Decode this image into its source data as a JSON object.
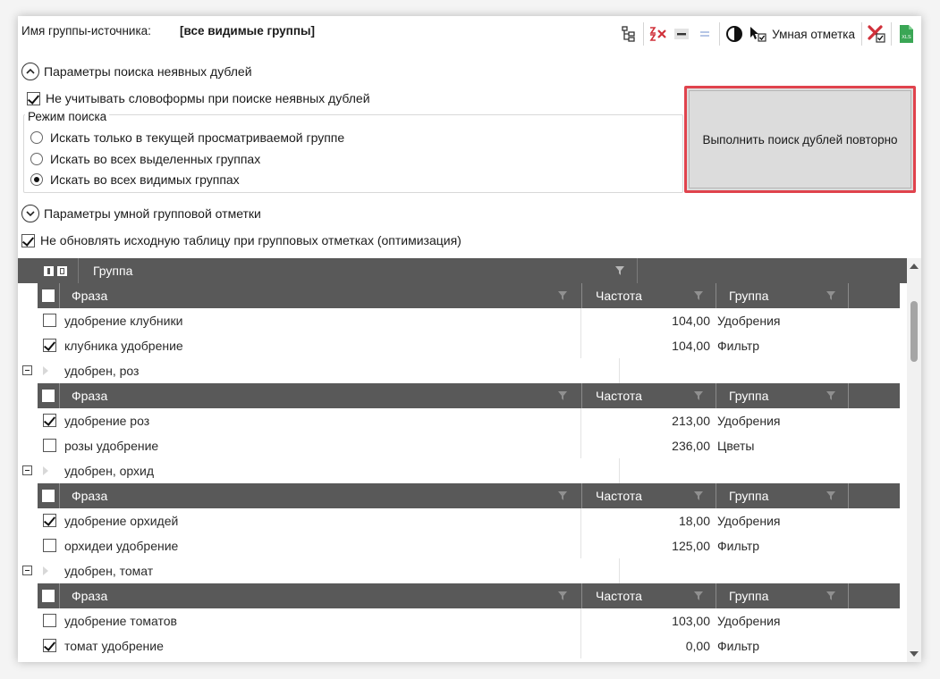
{
  "header": {
    "source_group_label": "Имя группы-источника:",
    "source_group_value": "[все видимые группы]",
    "smart_mark_label": "Умная отметка"
  },
  "toolbar_icons": [
    "tree-expand-icon",
    "clear-marks-icon",
    "minus-icon",
    "equals-icon",
    "contrast-icon",
    "smart-mark-icon",
    "delete-marked-icon",
    "export-excel-icon"
  ],
  "colors": {
    "accent_red": "#e0434d",
    "grid_header": "#595959",
    "excel_green": "#3aa655"
  },
  "search_params": {
    "title": "Параметры поиска неявных дублей",
    "ignore_wordforms_label": "Не учитывать словоформы при поиске неявных дублей",
    "ignore_wordforms_checked": true,
    "mode_title": "Режим поиска",
    "modes": [
      {
        "label": "Искать только в текущей просматриваемой группе",
        "selected": false
      },
      {
        "label": "Искать во всех выделенных группах",
        "selected": false
      },
      {
        "label": "Искать во всех видимых группах",
        "selected": true
      }
    ],
    "rerun_button": "Выполнить поиск дублей повторно"
  },
  "smart_params": {
    "title": "Параметры умной групповой отметки",
    "no_update_label": "Не обновлять исходную таблицу при групповых отметках (оптимизация)",
    "no_update_checked": true
  },
  "grid": {
    "top_header": {
      "column": "Группа"
    },
    "sub_header": {
      "phrase": "Фраза",
      "freq": "Частота",
      "group": "Группа"
    },
    "first_rows": [
      {
        "phrase": "удобрение клубники",
        "freq": "104,00",
        "group": "Удобрения",
        "checked": false
      },
      {
        "phrase": "клубника удобрение",
        "freq": "104,00",
        "group": "Фильтр",
        "checked": true
      }
    ],
    "groups": [
      {
        "name": "удобрен, роз",
        "rows": [
          {
            "phrase": "удобрение роз",
            "freq": "213,00",
            "group": "Удобрения",
            "checked": true
          },
          {
            "phrase": "розы удобрение",
            "freq": "236,00",
            "group": "Цветы",
            "checked": false
          }
        ]
      },
      {
        "name": "удобрен, орхид",
        "rows": [
          {
            "phrase": "удобрение орхидей",
            "freq": "18,00",
            "group": "Удобрения",
            "checked": true
          },
          {
            "phrase": "орхидеи удобрение",
            "freq": "125,00",
            "group": "Фильтр",
            "checked": false
          }
        ]
      },
      {
        "name": "удобрен, томат",
        "rows": [
          {
            "phrase": "удобрение томатов",
            "freq": "103,00",
            "group": "Удобрения",
            "checked": false
          },
          {
            "phrase": "томат удобрение",
            "freq": "0,00",
            "group": "Фильтр",
            "checked": true
          }
        ]
      }
    ]
  }
}
